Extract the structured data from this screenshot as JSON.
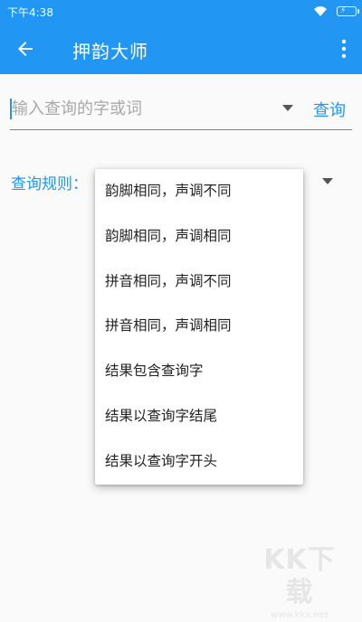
{
  "status": {
    "time": "下午4:38"
  },
  "appbar": {
    "title": "押韵大师"
  },
  "search": {
    "placeholder": "输入查询的字或词",
    "button_label": "查询"
  },
  "rule": {
    "label": "查询规则："
  },
  "menu": {
    "items": [
      "韵脚相同，声调不同",
      "韵脚相同，声调相同",
      "拼音相同，声调不同",
      "拼音相同，声调相同",
      "结果包含查询字",
      "结果以查询字结尾",
      "结果以查询字开头"
    ]
  },
  "watermark": {
    "logo": "KK下载",
    "url": "www.kkx.net"
  },
  "colors": {
    "primary": "#2196f3",
    "background": "#fafafa"
  },
  "icons": [
    "back-arrow-icon",
    "more-vertical-icon",
    "wifi-icon",
    "battery-charging-icon",
    "dropdown-arrow-icon"
  ]
}
